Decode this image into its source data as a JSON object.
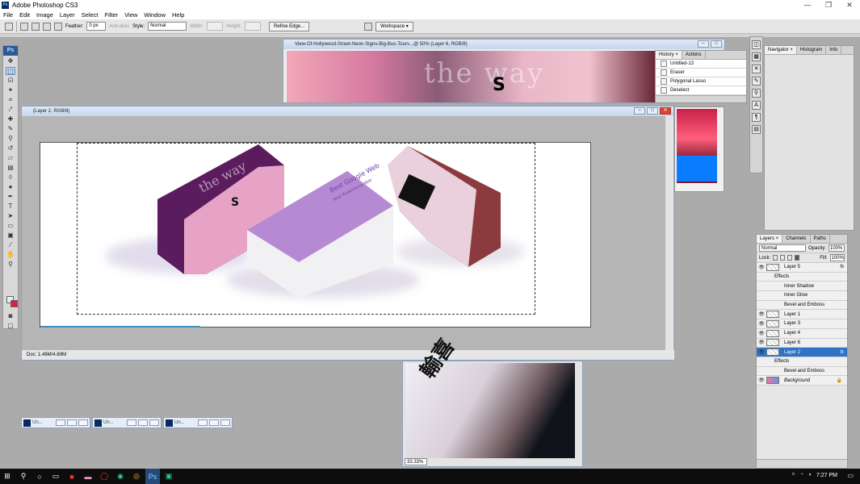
{
  "app": {
    "title": "Adobe Photoshop CS3",
    "icon": "photoshop-icon"
  },
  "window_controls": [
    "—",
    "❐",
    "✕"
  ],
  "menu": [
    "File",
    "Edit",
    "Image",
    "Layer",
    "Select",
    "Filter",
    "View",
    "Window",
    "Help"
  ],
  "options": {
    "feather_label": "Feather:",
    "feather_value": "0 px",
    "antialias": "Anti-alias",
    "style_label": "Style:",
    "style_value": "Normal",
    "width_label": "Width:",
    "height_label": "Height:",
    "refine_edge": "Refine Edge...",
    "workspace": "Workspace ▾"
  },
  "main_doc": {
    "title": "(Layer 2, RGB/8)",
    "status": "Doc: 1.46M/4.69M",
    "progress_fraction": 0.29
  },
  "bg_doc": {
    "title": "View-Of-Hollywood-Street-Neon-Signs-Big-Bus-Tours...@ 50% (Layer 6, RGB/8)",
    "image_text": "the way",
    "image_letter": "S"
  },
  "cards": {
    "purple_letter": "S",
    "purple_word": "the way",
    "white_line1": "Best Google Web",
    "white_line2": "Best Experience Web"
  },
  "history": {
    "tabs": [
      "History ×",
      "Actions"
    ],
    "snapshot": "Untitled-13",
    "items": [
      "Eraser",
      "Polygonal Lasso",
      "Deselect"
    ]
  },
  "navigator": {
    "tabs": [
      "Navigator ×",
      "Histogram",
      "Info"
    ]
  },
  "layers_panel": {
    "tabs": [
      "Layers ×",
      "Channels",
      "Paths"
    ],
    "blend": "Normal",
    "opacity_label": "Opacity:",
    "opacity_value": "100%",
    "lock_label": "Lock:",
    "fill_label": "Fill:",
    "fill_value": "100%",
    "rows": [
      {
        "name": "Layer 5",
        "type": "layer",
        "fx": "fx"
      },
      {
        "name": "Effects",
        "type": "effects"
      },
      {
        "name": "Inner Shadow",
        "type": "effect"
      },
      {
        "name": "Inner Glow",
        "type": "effect"
      },
      {
        "name": "Bevel and Emboss",
        "type": "effect"
      },
      {
        "name": "Layer 1",
        "type": "layer"
      },
      {
        "name": "Layer 3",
        "type": "layer"
      },
      {
        "name": "Layer 4",
        "type": "layer"
      },
      {
        "name": "Layer 6",
        "type": "layer"
      },
      {
        "name": "Layer 2",
        "type": "layer",
        "fx": "fx",
        "active": true
      },
      {
        "name": "Effects",
        "type": "effects"
      },
      {
        "name": "Bevel and Emboss",
        "type": "effect"
      },
      {
        "name": "Background",
        "type": "background"
      }
    ]
  },
  "bottom_doc": {
    "zoom": "33.33%"
  },
  "minimized": [
    "Un...",
    "Un...",
    "Un..."
  ],
  "taskbar": {
    "time": "7:27 PM"
  }
}
